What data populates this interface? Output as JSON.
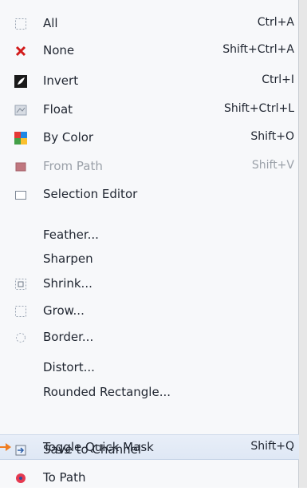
{
  "menu": {
    "items": [
      {
        "label": "All",
        "shortcut": "Ctrl+A",
        "icon": "select-all-icon"
      },
      {
        "label": "None",
        "shortcut": "Shift+Ctrl+A",
        "icon": "none-x-icon"
      },
      {
        "label": "Invert",
        "shortcut": "Ctrl+I",
        "icon": "invert-icon"
      },
      {
        "label": "Float",
        "shortcut": "Shift+Ctrl+L",
        "icon": "float-icon"
      },
      {
        "label": "By Color",
        "shortcut": "Shift+O",
        "icon": "by-color-icon"
      },
      {
        "label": "From Path",
        "shortcut": "Shift+V",
        "icon": "from-path-icon",
        "disabled": true
      },
      {
        "label": "Selection Editor",
        "shortcut": "",
        "icon": "selection-editor-icon"
      },
      {
        "label": "Feather...",
        "shortcut": "",
        "icon": ""
      },
      {
        "label": "Sharpen",
        "shortcut": "",
        "icon": ""
      },
      {
        "label": "Shrink...",
        "shortcut": "",
        "icon": "shrink-icon"
      },
      {
        "label": "Grow...",
        "shortcut": "",
        "icon": "grow-icon"
      },
      {
        "label": "Border...",
        "shortcut": "",
        "icon": "border-icon"
      },
      {
        "label": "Distort...",
        "shortcut": "",
        "icon": ""
      },
      {
        "label": "Rounded Rectangle...",
        "shortcut": "",
        "icon": ""
      },
      {
        "label": "Toggle Quick Mask",
        "shortcut": "Shift+Q",
        "icon": "",
        "highlighted": true
      },
      {
        "label": "Save to Channel",
        "shortcut": "",
        "icon": "save-to-channel-icon"
      },
      {
        "label": "To Path",
        "shortcut": "",
        "icon": "to-path-icon"
      }
    ]
  },
  "colors": {
    "highlight": "#dfe8f5",
    "arrow": "#ef7d21",
    "text": "#1f2530",
    "disabled_text": "#9aa0a8"
  }
}
